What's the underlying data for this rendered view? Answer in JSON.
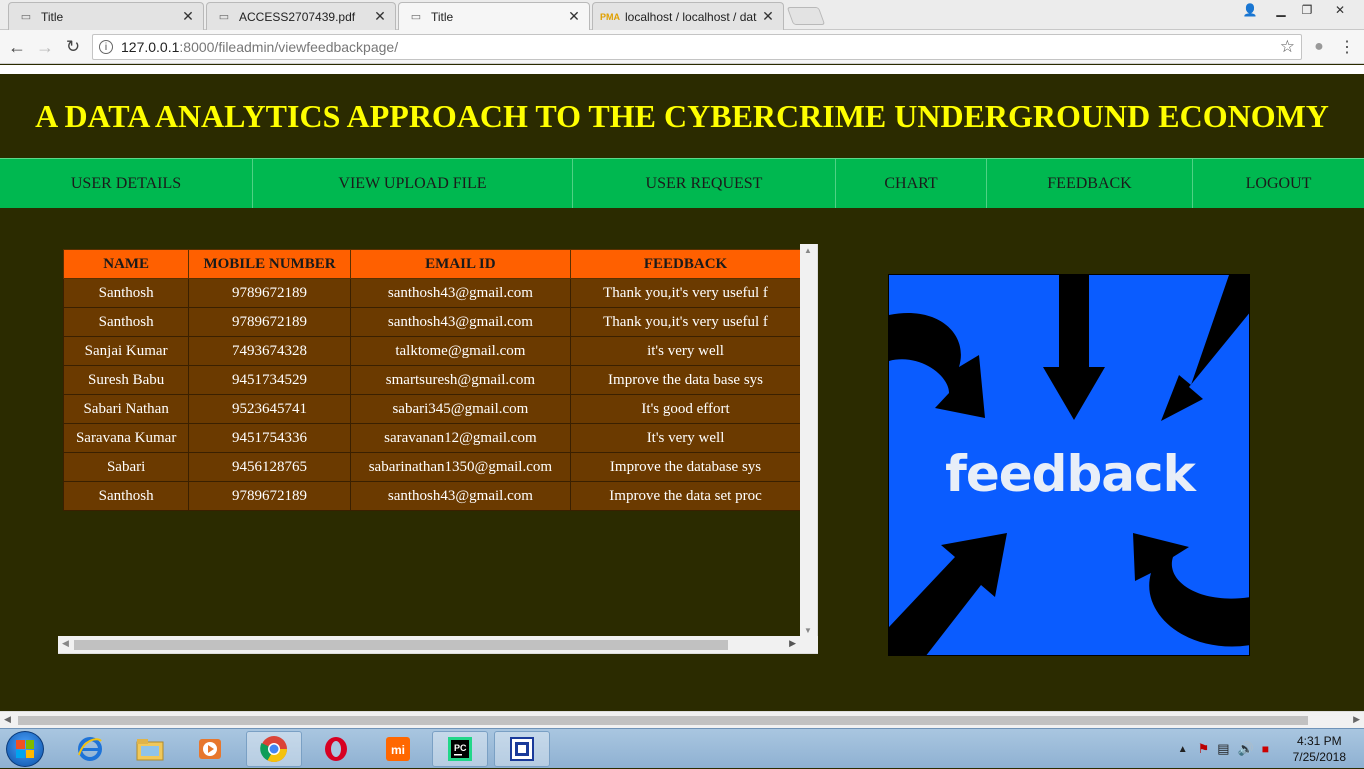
{
  "browser": {
    "tabs": [
      {
        "title": "Title",
        "icon": "page-icon",
        "active": false
      },
      {
        "title": "ACCESS2707439.pdf",
        "icon": "page-icon",
        "active": false
      },
      {
        "title": "Title",
        "icon": "page-icon",
        "active": true
      },
      {
        "title": "localhost / localhost / dat",
        "icon": "phpmyadmin-icon",
        "active": false
      }
    ],
    "url_host": "127.0.0.1",
    "url_path": ":8000/fileadmin/viewfeedbackpage/"
  },
  "header": {
    "title": "A DATA ANALYTICS APPROACH TO THE CYBERCRIME UNDERGROUND ECONOMY"
  },
  "menu": [
    "USER DETAILS",
    "VIEW UPLOAD FILE",
    "USER REQUEST",
    "CHART",
    "FEEDBACK",
    "LOGOUT"
  ],
  "table": {
    "columns": [
      "NAME",
      "MOBILE NUMBER",
      "EMAIL ID",
      "FEEDBACK"
    ],
    "rows": [
      [
        "Santhosh",
        "9789672189",
        "santhosh43@gmail.com",
        "Thank you,it's very useful f"
      ],
      [
        "Santhosh",
        "9789672189",
        "santhosh43@gmail.com",
        "Thank you,it's very useful f"
      ],
      [
        "Sanjai Kumar",
        "7493674328",
        "talktome@gmail.com",
        "it's very well"
      ],
      [
        "Suresh Babu",
        "9451734529",
        "smartsuresh@gmail.com",
        "Improve the data base sys"
      ],
      [
        "Sabari Nathan",
        "9523645741",
        "sabari345@gmail.com",
        "It's good effort"
      ],
      [
        "Saravana Kumar",
        "9451754336",
        "saravanan12@gmail.com",
        "It's very well"
      ],
      [
        "Sabari",
        "9456128765",
        "sabarinathan1350@gmail.com",
        "Improve the database sys"
      ],
      [
        "Santhosh",
        "9789672189",
        "santhosh43@gmail.com",
        "Improve the data set proc"
      ]
    ]
  },
  "feedback_image": {
    "word": "feedback",
    "bg_color": "#0a5cff"
  },
  "colors": {
    "page_bg": "#2b2b00",
    "title_color": "#ffff00",
    "menu_bg": "#00b850",
    "table_header": "#ff6000",
    "table_row": "#6b3a00"
  },
  "taskbar": {
    "time": "4:31 PM",
    "date": "7/25/2018",
    "apps": [
      "ie-icon",
      "explorer-icon",
      "media-player-icon",
      "chrome-icon",
      "opera-icon",
      "mi-icon",
      "pycharm-icon",
      "snipping-icon"
    ]
  }
}
